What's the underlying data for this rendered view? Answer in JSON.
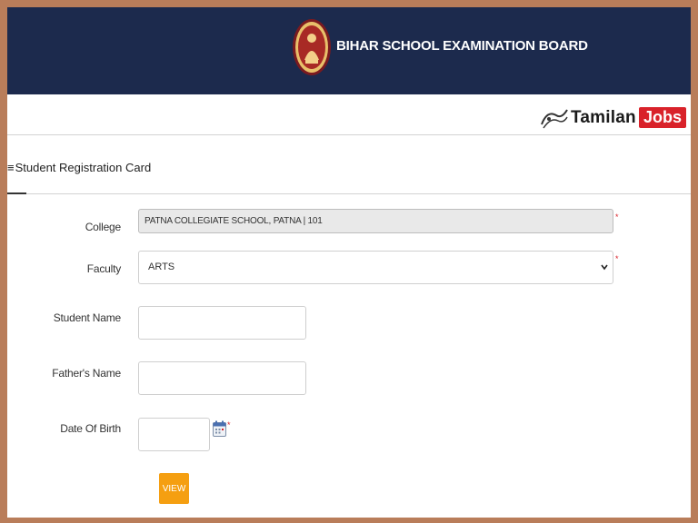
{
  "header": {
    "title": "BIHAR SCHOOL EXAMINATION BOARD",
    "emblem_icon": "bseb-emblem-icon",
    "background": "#1c2a4d"
  },
  "watermark": {
    "name": "Tamilan",
    "badge": "Jobs",
    "icon": "swirl-logo-icon",
    "badge_color": "#d9222a"
  },
  "section": {
    "icon": "menu-icon",
    "title": "Student Registration Card"
  },
  "form": {
    "college": {
      "label": "College",
      "value": "PATNA COLLEGIATE SCHOOL, PATNA | 101"
    },
    "faculty": {
      "label": "Faculty",
      "value": "ARTS"
    },
    "student_name": {
      "label": "Student Name",
      "value": ""
    },
    "fathers_name": {
      "label": "Father's Name",
      "value": ""
    },
    "dob": {
      "label": "Date Of Birth",
      "value": "",
      "icon": "calendar-icon"
    },
    "required_mark": "*",
    "submit_label": "VIEW",
    "submit_color": "#f59f11"
  }
}
